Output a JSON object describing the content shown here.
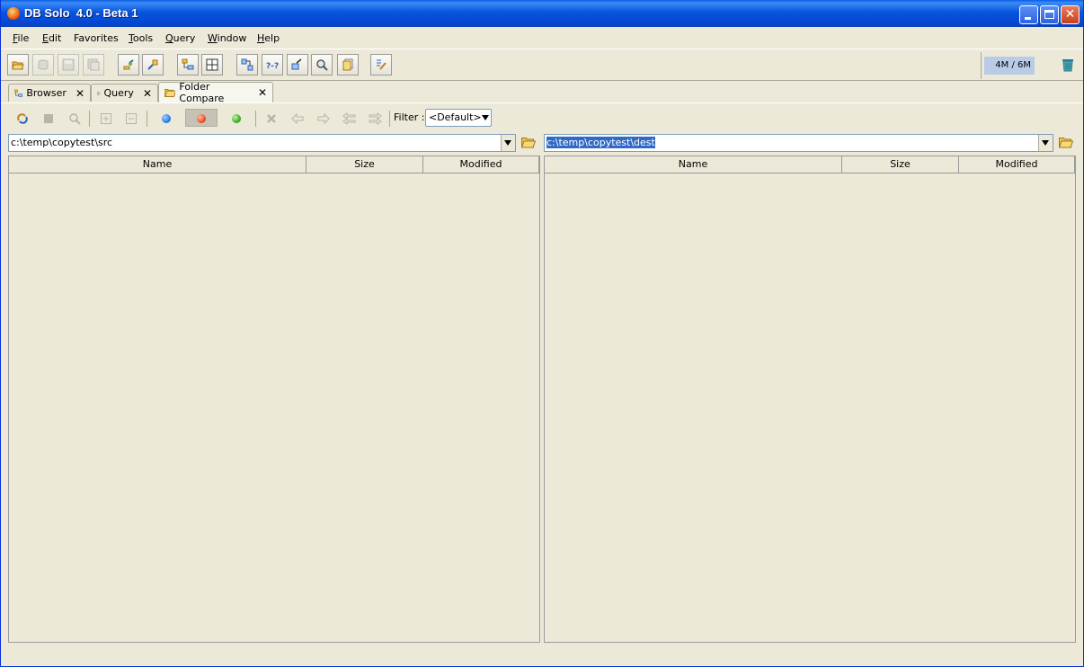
{
  "window": {
    "title": "DB Solo  4.0 - Beta 1"
  },
  "menu": [
    {
      "mnemonic": "F",
      "rest": "ile"
    },
    {
      "mnemonic": "E",
      "rest": "dit"
    },
    {
      "mnemonic": "",
      "rest": "Favorites"
    },
    {
      "mnemonic": "T",
      "rest": "ools"
    },
    {
      "mnemonic": "Q",
      "rest": "uery"
    },
    {
      "mnemonic": "W",
      "rest": "indow"
    },
    {
      "mnemonic": "H",
      "rest": "elp"
    }
  ],
  "memory": {
    "label": "4M / 6M",
    "used_fraction": 0.67
  },
  "tabs": [
    {
      "label": "Browser"
    },
    {
      "label": "Query"
    },
    {
      "label": "Folder Compare"
    }
  ],
  "compare": {
    "filter_label": "Filter :",
    "filter_value": "<Default>",
    "left_path": "c:\\temp\\copytest\\src",
    "right_path": "c:\\temp\\copytest\\dest",
    "columns": [
      "Name",
      "Size",
      "Modified"
    ]
  },
  "colors": {
    "accent": "#316ac5",
    "title_blue": "#0855dd",
    "face": "#ece9d8"
  }
}
